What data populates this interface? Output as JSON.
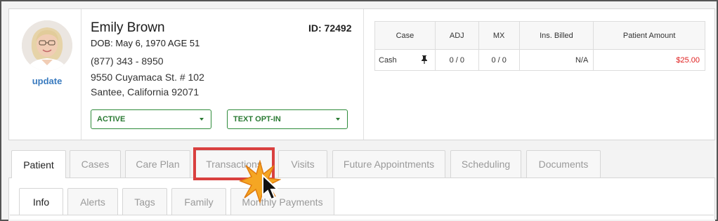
{
  "patient": {
    "name": "Emily Brown",
    "id_label": "ID: 72492",
    "dob_line": "DOB: May 6, 1970 AGE 51",
    "phone": "(877) 343 - 8950",
    "address_line1": "9550 Cuyamaca St. # 102",
    "address_line2": "Santee, California 92071",
    "update_link": "update"
  },
  "status_dropdown": {
    "value": "ACTIVE"
  },
  "text_dropdown": {
    "value": "TEXT OPT-IN"
  },
  "cases_table": {
    "headers": [
      "Case",
      "ADJ",
      "MX",
      "Ins. Billed",
      "Patient Amount"
    ],
    "rows": [
      {
        "case": "Cash",
        "adj": "0 / 0",
        "mx": "0 / 0",
        "ins_billed": "N/A",
        "patient_amount": "$25.00"
      }
    ]
  },
  "main_tabs": [
    {
      "label": "Patient",
      "active": true
    },
    {
      "label": "Cases"
    },
    {
      "label": "Care Plan"
    },
    {
      "label": "Transactions",
      "highlighted": true
    },
    {
      "label": "Visits"
    },
    {
      "label": "Future Appointments"
    },
    {
      "label": "Scheduling"
    },
    {
      "label": "Documents"
    }
  ],
  "sub_tabs": [
    {
      "label": "Info",
      "active": true
    },
    {
      "label": "Alerts"
    },
    {
      "label": "Tags"
    },
    {
      "label": "Family"
    },
    {
      "label": "Monthly Payments"
    }
  ],
  "colors": {
    "link": "#3a7bbf",
    "status_green": "#2a7a33",
    "amount_red": "#e02020",
    "highlight_red": "#d9403f",
    "burst_orange": "#f5a623"
  },
  "icons": {
    "pin": "pin-icon",
    "cursor": "mouse-pointer-icon",
    "click": "click-burst-icon"
  }
}
